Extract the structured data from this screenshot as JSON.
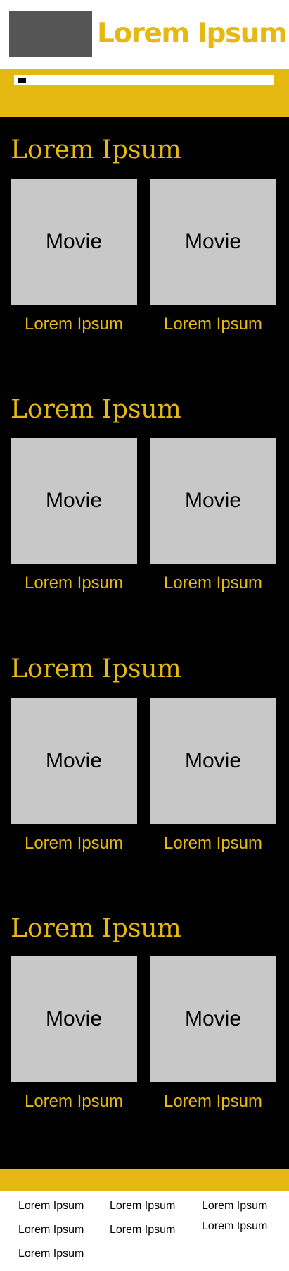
{
  "header": {
    "logo_icon": "logo-placeholder",
    "title": "Lorem Ipsum"
  },
  "search": {
    "value": "",
    "icon": "search-icon"
  },
  "sections": [
    {
      "title": "Lorem Ipsum",
      "cards": [
        {
          "poster": "Movie",
          "title": "Lorem Ipsum"
        },
        {
          "poster": "Movie",
          "title": "Lorem Ipsum"
        }
      ]
    },
    {
      "title": "Lorem Ipsum",
      "cards": [
        {
          "poster": "Movie",
          "title": "Lorem Ipsum"
        },
        {
          "poster": "Movie",
          "title": "Lorem Ipsum"
        }
      ]
    },
    {
      "title": "Lorem Ipsum",
      "cards": [
        {
          "poster": "Movie",
          "title": "Lorem Ipsum"
        },
        {
          "poster": "Movie",
          "title": "Lorem Ipsum"
        }
      ]
    },
    {
      "title": "Lorem Ipsum",
      "cards": [
        {
          "poster": "Movie",
          "title": "Lorem Ipsum"
        },
        {
          "poster": "Movie",
          "title": "Lorem Ipsum"
        }
      ]
    }
  ],
  "footer": {
    "columns": [
      [
        "Lorem Ipsum",
        "Lorem Ipsum",
        "Lorem Ipsum"
      ],
      [
        "Lorem Ipsum",
        "Lorem Ipsum"
      ],
      [
        "Lorem Ipsum",
        "Lorem Ipsum"
      ]
    ]
  },
  "colors": {
    "accent": "#e5b912",
    "background": "#000000",
    "poster": "#c8c8c8",
    "logo": "#555555"
  }
}
